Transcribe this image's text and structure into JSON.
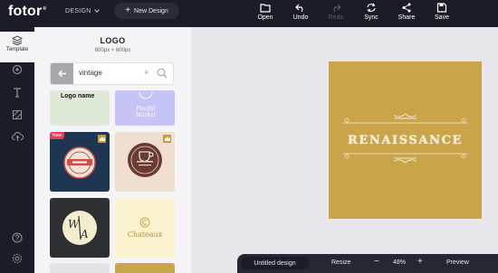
{
  "topbar": {
    "logo": "fotor",
    "logo_mark": "®",
    "design_menu": "DESIGN",
    "new_design": "New Design",
    "tools": [
      {
        "label": "Open",
        "icon": "open-icon",
        "enabled": true
      },
      {
        "label": "Undo",
        "icon": "undo-icon",
        "enabled": true
      },
      {
        "label": "Redo",
        "icon": "redo-icon",
        "enabled": false
      },
      {
        "label": "Sync",
        "icon": "sync-icon",
        "enabled": true
      },
      {
        "label": "Share",
        "icon": "share-icon",
        "enabled": true
      },
      {
        "label": "Save",
        "icon": "save-icon",
        "enabled": true
      }
    ]
  },
  "sidebar": {
    "items": [
      {
        "label": "Template",
        "icon": "layers-icon",
        "active": true
      },
      {
        "label": "",
        "icon": "settings-icon",
        "active": false
      },
      {
        "label": "",
        "icon": "text-icon",
        "active": false
      },
      {
        "label": "",
        "icon": "background-icon",
        "active": false
      },
      {
        "label": "",
        "icon": "upload-icon",
        "active": false
      },
      {
        "label": "",
        "icon": "help-icon",
        "active": false
      },
      {
        "label": "",
        "icon": "gear-icon",
        "active": false
      }
    ]
  },
  "panel": {
    "title": "LOGO",
    "subtitle": "600px × 600px",
    "search": {
      "value": "vintage",
      "clear": "×"
    },
    "thumbnails": [
      {
        "label": "Logo name"
      },
      {
        "label": "Pineful Market"
      },
      {
        "label": "",
        "badge": "New",
        "premium": true
      },
      {
        "label": "",
        "premium": true
      },
      {
        "label": "W/A"
      },
      {
        "label": "Chateaux"
      },
      {
        "label": ""
      },
      {
        "label": ""
      }
    ]
  },
  "canvas": {
    "artboard_text": "RENAISSANCE",
    "artboard_color": "#c9a449"
  },
  "bottombar": {
    "filename": "Untitled design",
    "resize": "Resize",
    "zoom_out": "−",
    "zoom": "48%",
    "zoom_in": "+",
    "preview": "Preview"
  },
  "colors": {
    "dark": "#1b1c27",
    "panel": "#f4f4f6",
    "accent_gold": "#c9a449",
    "new_badge": "#ee3a5a"
  }
}
